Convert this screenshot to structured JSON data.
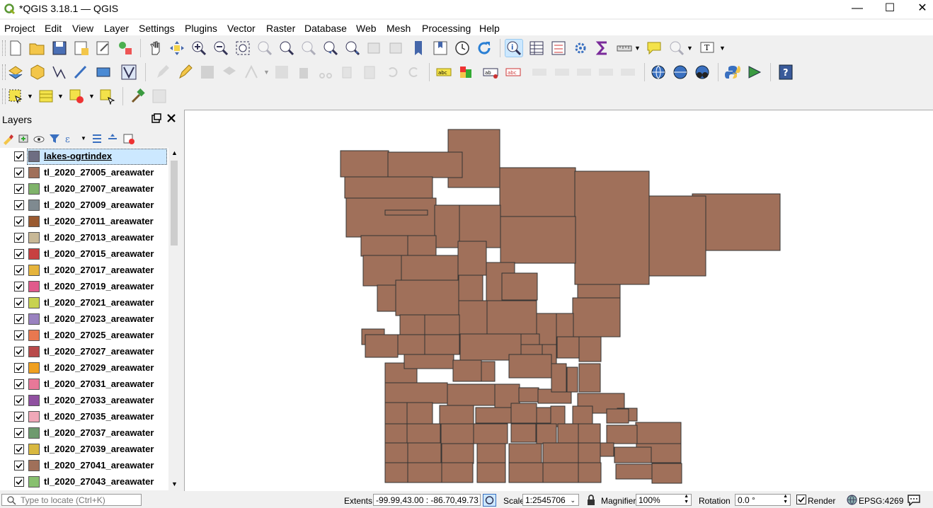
{
  "window": {
    "title": "*QGIS 3.18.1 — QGIS"
  },
  "menu": [
    "Project",
    "Edit",
    "View",
    "Layer",
    "Settings",
    "Plugins",
    "Vector",
    "Raster",
    "Database",
    "Web",
    "Mesh",
    "Processing",
    "Help"
  ],
  "layers_panel": {
    "title": "Layers",
    "layers": [
      {
        "name": "lakes-ogrtindex",
        "color": "#6e6e82",
        "selected": true
      },
      {
        "name": "tl_2020_27005_areawater",
        "color": "#a0705a"
      },
      {
        "name": "tl_2020_27007_areawater",
        "color": "#7fb36a"
      },
      {
        "name": "tl_2020_27009_areawater",
        "color": "#7f8a90"
      },
      {
        "name": "tl_2020_27011_areawater",
        "color": "#9a5a30"
      },
      {
        "name": "tl_2020_27013_areawater",
        "color": "#c8b896"
      },
      {
        "name": "tl_2020_27015_areawater",
        "color": "#c84040"
      },
      {
        "name": "tl_2020_27017_areawater",
        "color": "#e6b43c"
      },
      {
        "name": "tl_2020_27019_areawater",
        "color": "#e05a8c"
      },
      {
        "name": "tl_2020_27021_areawater",
        "color": "#c8d250"
      },
      {
        "name": "tl_2020_27023_areawater",
        "color": "#9a82c0"
      },
      {
        "name": "tl_2020_27025_areawater",
        "color": "#e87850"
      },
      {
        "name": "tl_2020_27027_areawater",
        "color": "#b84a4a"
      },
      {
        "name": "tl_2020_27029_areawater",
        "color": "#f0a020"
      },
      {
        "name": "tl_2020_27031_areawater",
        "color": "#e87898"
      },
      {
        "name": "tl_2020_27033_areawater",
        "color": "#9050a0"
      },
      {
        "name": "tl_2020_27035_areawater",
        "color": "#f0a8b8"
      },
      {
        "name": "tl_2020_27037_areawater",
        "color": "#6e9a6e"
      },
      {
        "name": "tl_2020_27039_areawater",
        "color": "#d8b840"
      },
      {
        "name": "tl_2020_27041_areawater",
        "color": "#a0705a"
      },
      {
        "name": "tl_2020_27043_areawater",
        "color": "#88c070"
      }
    ]
  },
  "map": {
    "fill_color": "#a0705a",
    "stroke_color": "#333333"
  },
  "status": {
    "locate_placeholder": "Type to locate (Ctrl+K)",
    "extents_label": "Extents",
    "extents_value": "-99.99,43.00 : -86.70,49.73",
    "scale_label": "Scale",
    "scale_value": "1:2545706",
    "magnifier_label": "Magnifier",
    "magnifier_value": "100%",
    "rotation_label": "Rotation",
    "rotation_value": "0.0 °",
    "render_label": "Render",
    "crs": "EPSG:4269"
  }
}
